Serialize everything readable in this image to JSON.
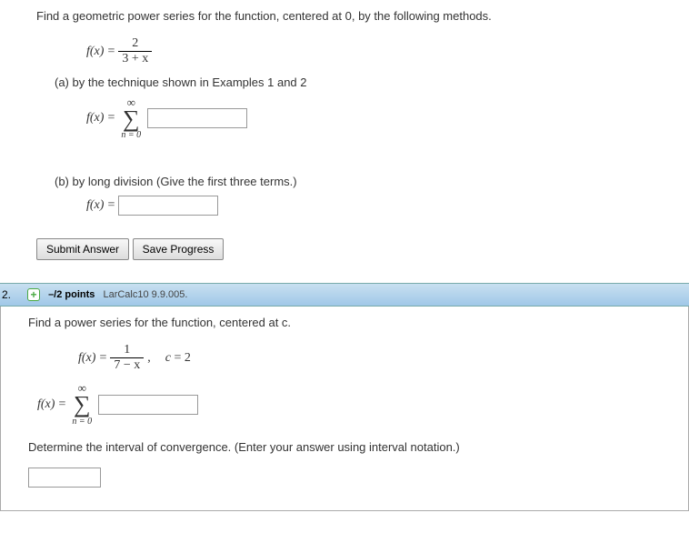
{
  "q1": {
    "prompt": "Find a geometric power series for the function, centered at 0, by the following methods.",
    "fx": "f(x)",
    "eq": "=",
    "frac1_num": "2",
    "frac1_den": "3 + x",
    "partA": "(a) by the technique shown in Examples 1 and 2",
    "sum_inf": "∞",
    "sum_lower": "n = 0",
    "partB": "(b) by long division (Give the first three terms.)",
    "submit": "Submit Answer",
    "save": "Save Progress"
  },
  "q2": {
    "number": "2.",
    "expand": "+",
    "points": "–/2 points",
    "ref": "LarCalc10 9.9.005.",
    "prompt": "Find a power series for the function, centered at c.",
    "frac_num": "1",
    "frac_den": "7 − x",
    "comma": ",",
    "cval": "c = 2",
    "interval_prompt": "Determine the interval of convergence. (Enter your answer using interval notation.)"
  }
}
